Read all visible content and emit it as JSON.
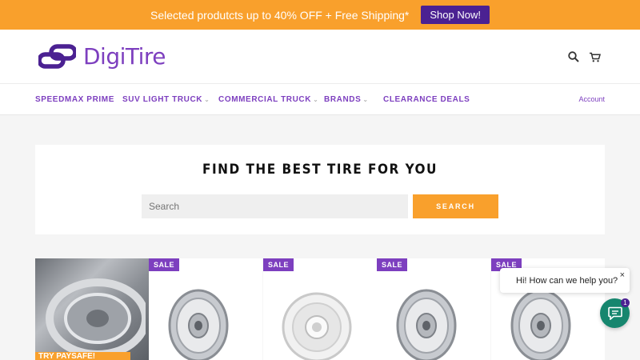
{
  "promo": {
    "text": "Selected produtcts up to 40% OFF + Free Shipping*",
    "button": "Shop Now!"
  },
  "brand": {
    "name": "DigiTire"
  },
  "header_icons": [
    "search-icon",
    "cart-icon"
  ],
  "nav": {
    "items": [
      {
        "label": "SPEEDMAX PRIME",
        "dropdown": false
      },
      {
        "label": "SUV LIGHT TRUCK",
        "dropdown": true
      },
      {
        "label": "COMMERCIAL TRUCK",
        "dropdown": true
      },
      {
        "label": "BRANDS",
        "dropdown": true
      },
      {
        "label": "CLEARANCE DEALS",
        "dropdown": false
      }
    ],
    "account": "Account"
  },
  "search": {
    "title": "FIND THE BEST TIRE FOR YOU",
    "placeholder": "Search",
    "button": "SEARCH"
  },
  "products": [
    {
      "kind": "feature",
      "banner": "TRY PAYSAFE!"
    },
    {
      "kind": "wheel",
      "badge": "SALE",
      "finish": "polished"
    },
    {
      "kind": "wheel",
      "badge": "SALE",
      "finish": "white"
    },
    {
      "kind": "wheel",
      "badge": "SALE",
      "finish": "polished"
    },
    {
      "kind": "wheel",
      "badge": "SALE",
      "finish": "polished"
    }
  ],
  "chat": {
    "message": "Hi! How can we help you?",
    "close": "×",
    "unread": "1"
  },
  "colors": {
    "accent_orange": "#f9a02c",
    "brand_purple": "#7d3fbf",
    "deep_purple": "#4b2192",
    "chat_green": "#16866e"
  }
}
